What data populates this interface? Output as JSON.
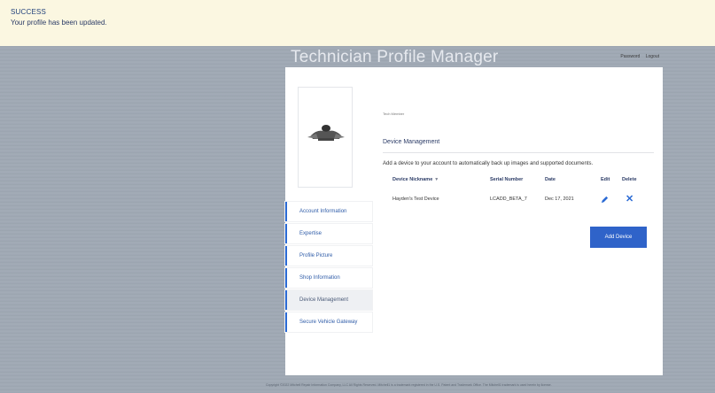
{
  "banner": {
    "title": "SUCCESS",
    "message": "Your profile has been updated."
  },
  "header": {
    "app_title": "Technician Profile Manager",
    "links": [
      "Password",
      "Logout"
    ]
  },
  "profile": {
    "user_name": "Tech Member"
  },
  "sidebar": {
    "items": [
      {
        "label": "Account Information"
      },
      {
        "label": "Expertise"
      },
      {
        "label": "Profile Picture"
      },
      {
        "label": "Shop Information"
      },
      {
        "label": "Device Management",
        "active": true
      },
      {
        "label": "Secure Vehicle Gateway"
      }
    ]
  },
  "device_management": {
    "heading": "Device Management",
    "description": "Add a device to your account to automatically back up images and supported documents.",
    "columns": {
      "nickname": "Device Nickname",
      "serial": "Serial Number",
      "date": "Date",
      "edit": "Edit",
      "delete": "Delete"
    },
    "rows": [
      {
        "nickname": "Hayden's Test Device",
        "serial": "LCADD_BETA_7",
        "date": "Dec 17, 2021"
      }
    ],
    "add_button": "Add Device"
  },
  "footer": {
    "text": "Copyright ©2022 Mitchell Repair Information Company, LLC All Rights Reserved. Mitchell1 is a trademark registered in the U.S. Patent and Trademark Office. The Mitchell1 trademark is used herein by license."
  },
  "icons": {
    "sort": "sort-icon",
    "edit": "pencil-icon",
    "delete": "x-icon",
    "avatar": "car-hero-image"
  },
  "colors": {
    "accent": "#2f63c9",
    "banner_bg": "#fbf7e1",
    "banner_text": "#1f3f7a"
  }
}
